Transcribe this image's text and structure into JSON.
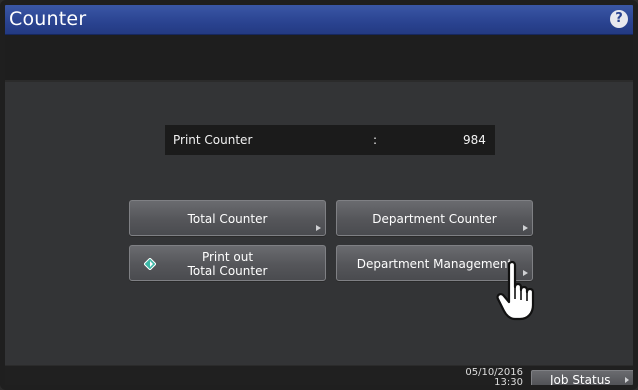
{
  "window": {
    "title": "Counter",
    "help_icon": "help-icon"
  },
  "counter_readout": {
    "label": "Print Counter",
    "separator": ":",
    "value": "984"
  },
  "buttons": {
    "total_counter": "Total Counter",
    "department_counter": "Department Counter",
    "print_out_line1": "Print out",
    "print_out_line2": "Total Counter",
    "department_management": "Department Management"
  },
  "footer": {
    "date": "05/10/2016",
    "time": "13:30",
    "job_status": "Job Status"
  },
  "colors": {
    "titlebar": "#2a4390",
    "start_icon": "#3cb7a6"
  }
}
